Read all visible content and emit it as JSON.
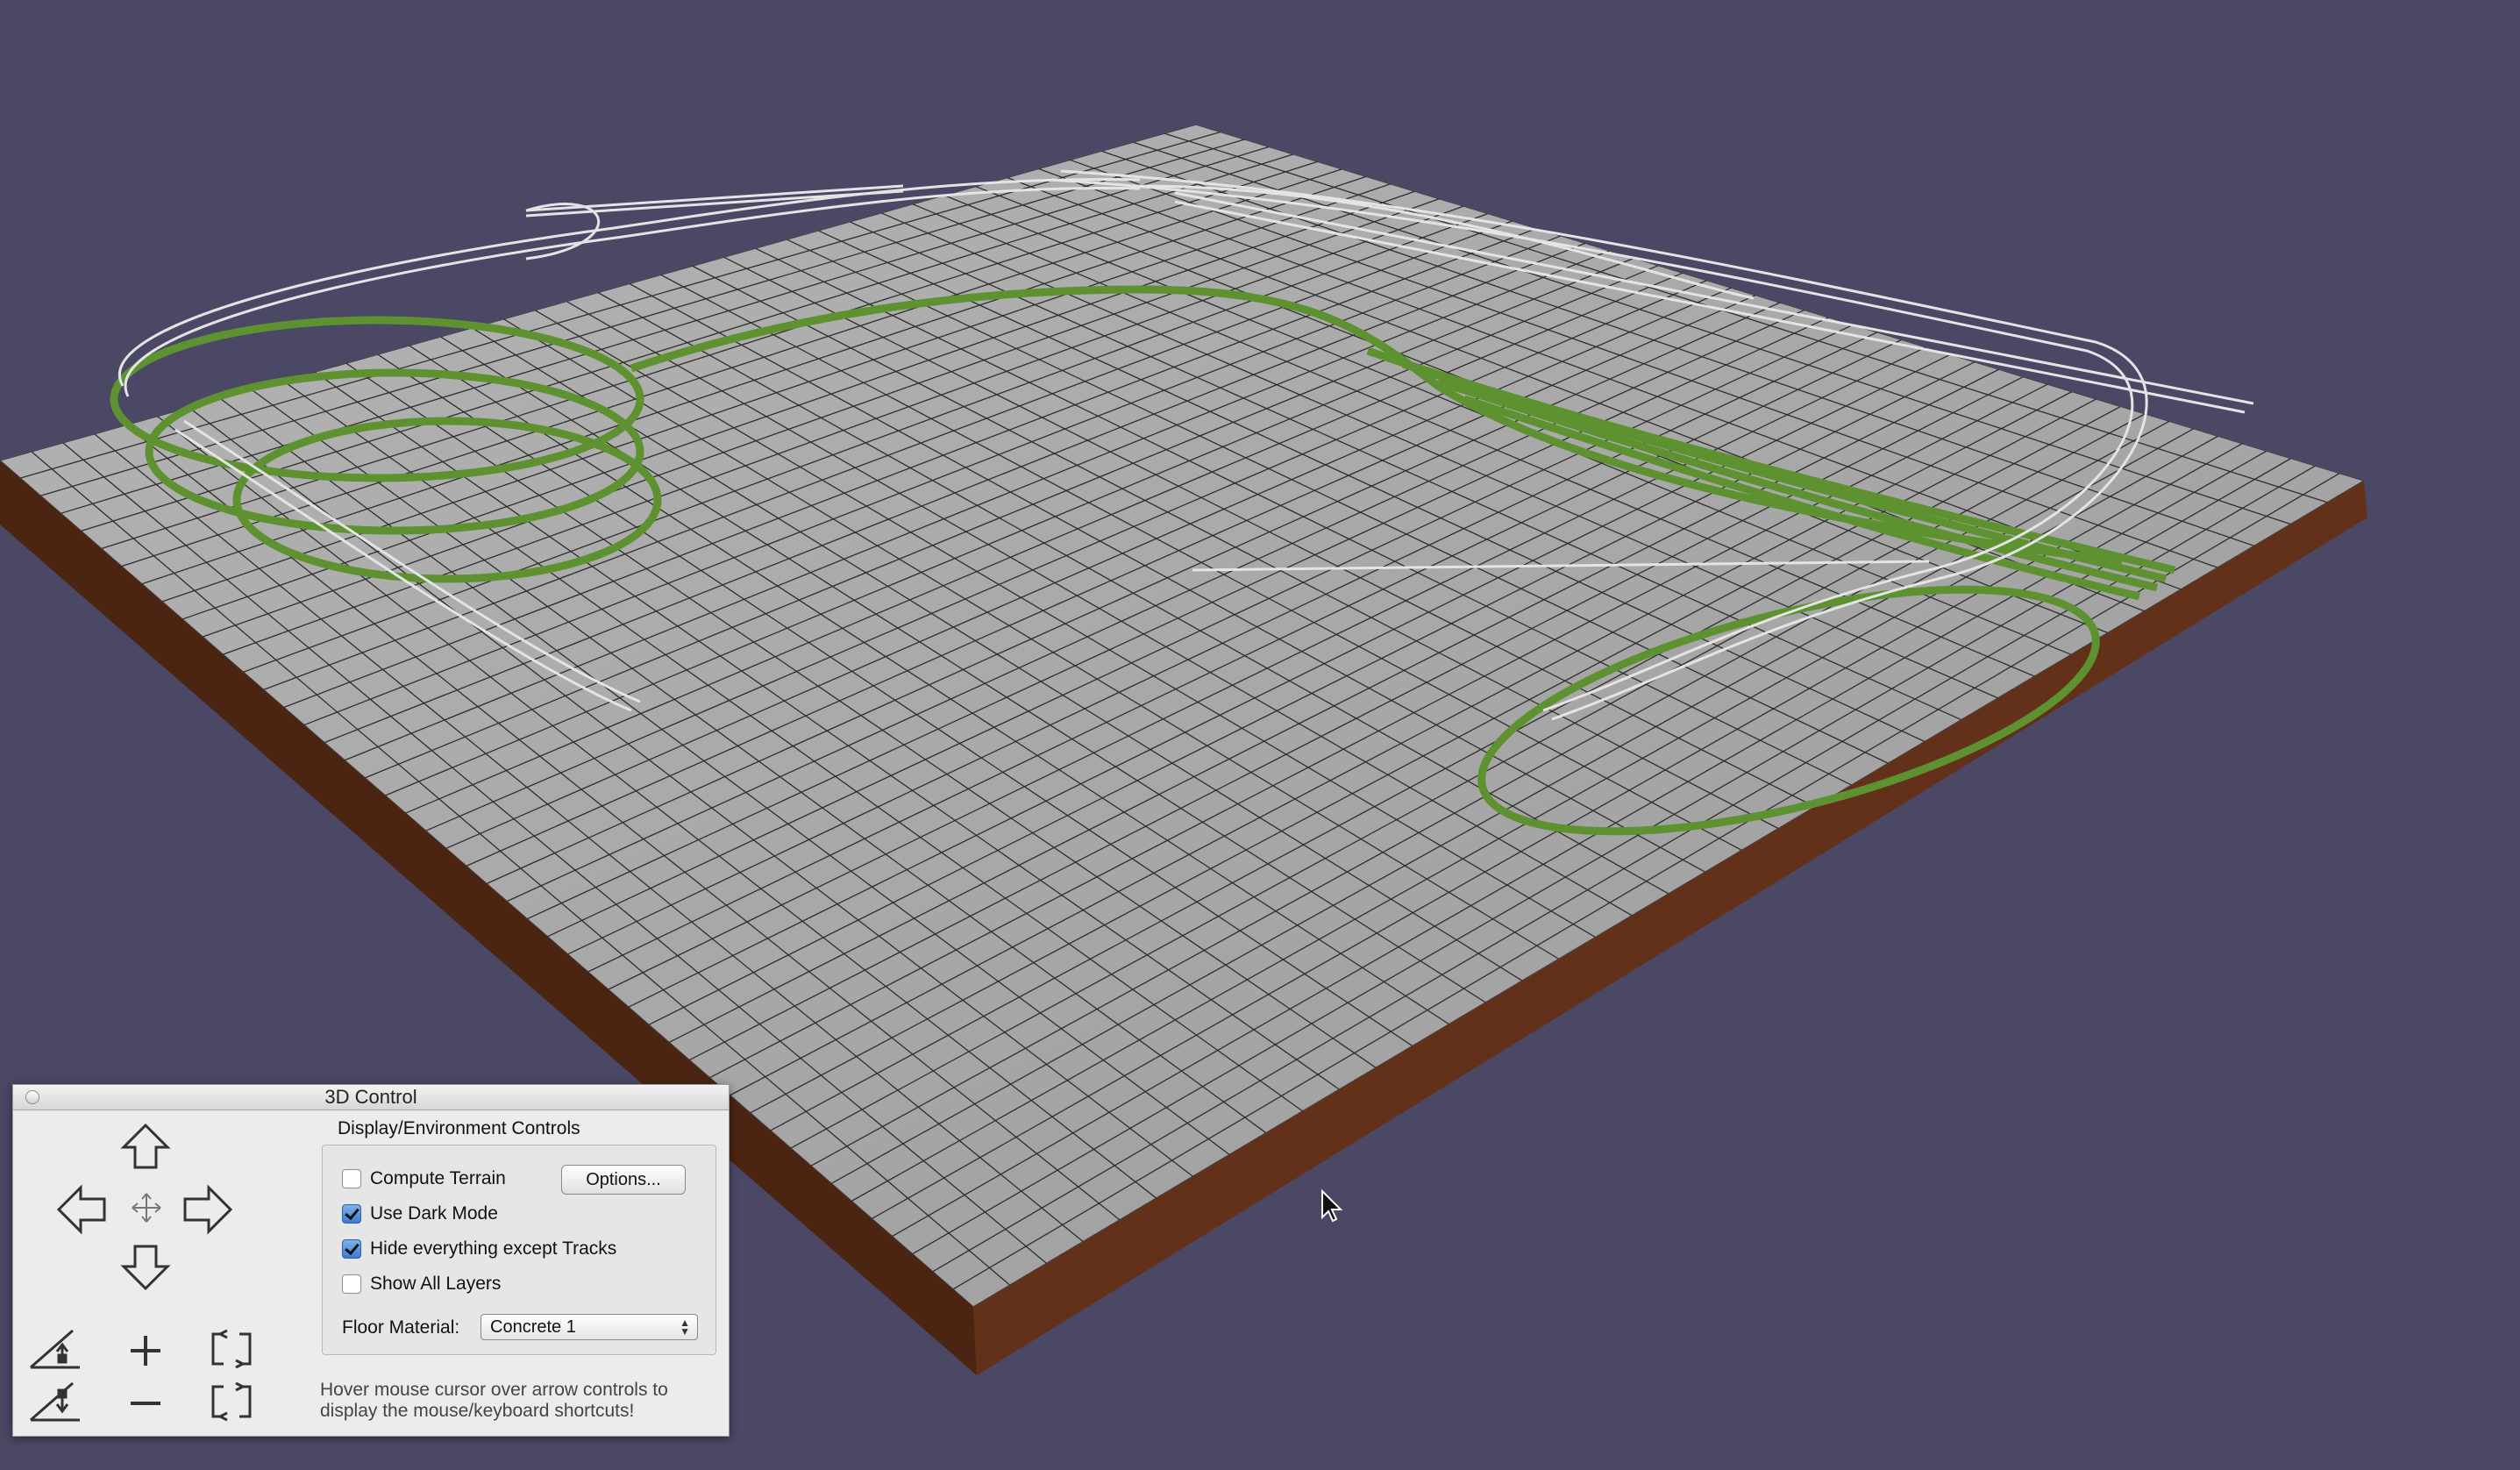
{
  "scene": {
    "background_color": "#4a4865",
    "floor_color": "#a6a6a6",
    "base_color": "#5a2b16",
    "track_color": "#5e9231",
    "rail_color": "#e4e4e4",
    "cursor_icon": "arrow-cursor-icon"
  },
  "panel": {
    "title": "3D Control",
    "group_label": "Display/Environment Controls",
    "options": [
      {
        "label": "Compute Terrain",
        "checked": false
      },
      {
        "label": "Use Dark Mode",
        "checked": true
      },
      {
        "label": "Hide everything except Tracks",
        "checked": true
      },
      {
        "label": "Show All Layers",
        "checked": false
      }
    ],
    "options_button": "Options...",
    "floor_material_label": "Floor Material:",
    "floor_material_value": "Concrete 1",
    "hint_line1": "Hover mouse cursor over arrow controls to",
    "hint_line2": "display the mouse/keyboard shortcuts!",
    "icons": [
      "arrow-up-icon",
      "arrow-left-icon",
      "center-move-icon",
      "arrow-right-icon",
      "arrow-down-icon",
      "tilt-up-icon",
      "tilt-down-icon",
      "zoom-in-icon",
      "zoom-out-icon",
      "rotate-left-icon",
      "rotate-right-icon"
    ]
  }
}
